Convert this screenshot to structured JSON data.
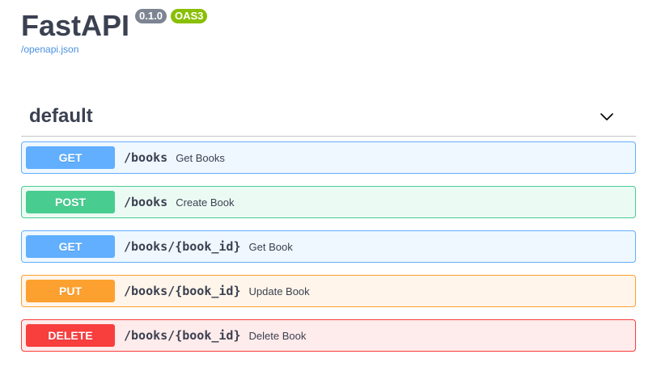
{
  "info": {
    "title": "FastAPI",
    "version": "0.1.0",
    "oas": "OAS3",
    "spec_link": "/openapi.json"
  },
  "tag": {
    "name": "default",
    "expanded": true,
    "toggle_icon": "chevron-down-icon"
  },
  "colors": {
    "get": "#61affe",
    "post": "#49cc90",
    "put": "#fca130",
    "delete": "#f93e3e",
    "version_badge": "#7d8492",
    "oas_badge": "#89bf04",
    "link": "#4990e2"
  },
  "operations": [
    {
      "method": "GET",
      "path": "/books",
      "summary": "Get Books"
    },
    {
      "method": "POST",
      "path": "/books",
      "summary": "Create Book"
    },
    {
      "method": "GET",
      "path": "/books/{book_id}",
      "summary": "Get Book"
    },
    {
      "method": "PUT",
      "path": "/books/{book_id}",
      "summary": "Update Book"
    },
    {
      "method": "DELETE",
      "path": "/books/{book_id}",
      "summary": "Delete Book"
    }
  ]
}
